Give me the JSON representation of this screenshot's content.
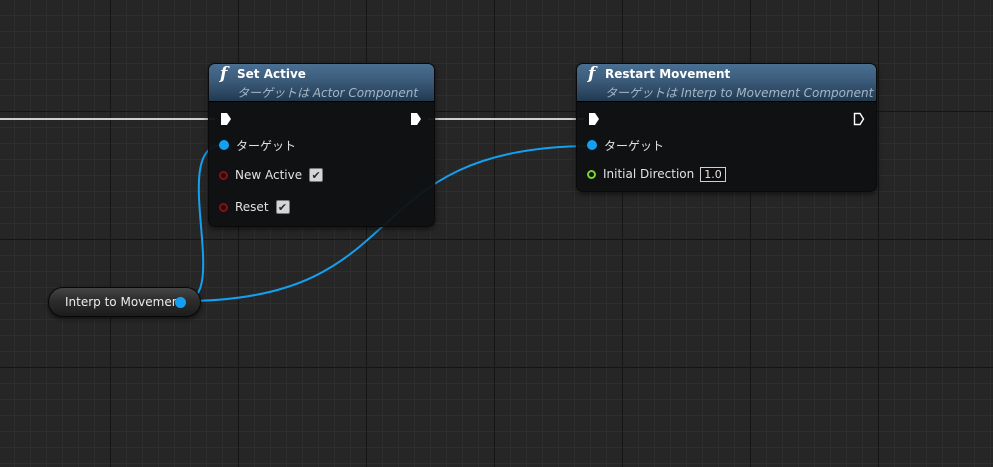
{
  "colors": {
    "object_pin": "#14a0f0",
    "bool_pin": "#8c0f12",
    "float_pin": "#7bd42a",
    "exec_pin": "#ffffff",
    "header_blue": "#3b5b7a"
  },
  "nodes": {
    "set_active": {
      "icon": "function-icon",
      "icon_glyph": "f",
      "title": "Set Active",
      "subtitle": "ターゲットは Actor Component",
      "pins": {
        "target_label": "ターゲット",
        "new_active_label": "New Active",
        "new_active_checked": true,
        "reset_label": "Reset",
        "reset_checked": true
      }
    },
    "restart_movement": {
      "icon": "function-icon",
      "icon_glyph": "f",
      "title": "Restart Movement",
      "subtitle": "ターゲットは Interp to Movement Component",
      "pins": {
        "target_label": "ターゲット",
        "initial_direction_label": "Initial Direction",
        "initial_direction_value": "1.0"
      }
    },
    "variable": {
      "label": "Interp to Movement"
    }
  },
  "check_glyph": "✔"
}
